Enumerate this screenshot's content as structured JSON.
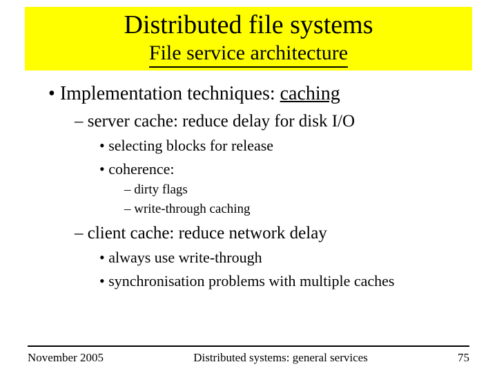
{
  "header": {
    "title": "Distributed file systems",
    "subtitle": "File service architecture"
  },
  "bullets": {
    "l1_prefix": "Implementation techniques: ",
    "l1_underlined": "caching",
    "l2a": "server cache: reduce delay for disk I/O",
    "l3a": "selecting blocks for release",
    "l3b": "coherence:",
    "l4a": "dirty flags",
    "l4b": "write-through caching",
    "l2b": "client cache: reduce network delay",
    "l3c": "always use write-through",
    "l3d": "synchronisation problems with multiple caches"
  },
  "footer": {
    "date": "November 2005",
    "center": "Distributed systems: general services",
    "page": "75"
  }
}
